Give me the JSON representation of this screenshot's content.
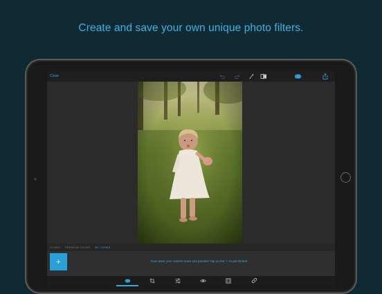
{
  "headline": "Create and save your own unique photo filters.",
  "editor": {
    "close_label": "Close",
    "tabs": [
      {
        "label": "LOOKS"
      },
      {
        "label": "PREMIUM LOOKS"
      },
      {
        "label": "MY LOOKS"
      }
    ],
    "active_tab": "MY LOOKS",
    "add_look_label": "+",
    "hint": "Now Save your custom looks and presets! Tap on the '+' to get started"
  },
  "icons": {
    "undo": "undo-icon",
    "redo": "redo-icon",
    "magic_wand": "magic-wand-icon",
    "compare": "compare-icon",
    "looks": "looks-icon",
    "share": "share-icon",
    "crop": "crop-icon",
    "adjust": "adjust-icon",
    "red_eye": "eye-icon",
    "frames": "frame-icon",
    "heal": "bandage-icon"
  },
  "colors": {
    "background": "#0f2a33",
    "accent": "#39a7e0"
  }
}
